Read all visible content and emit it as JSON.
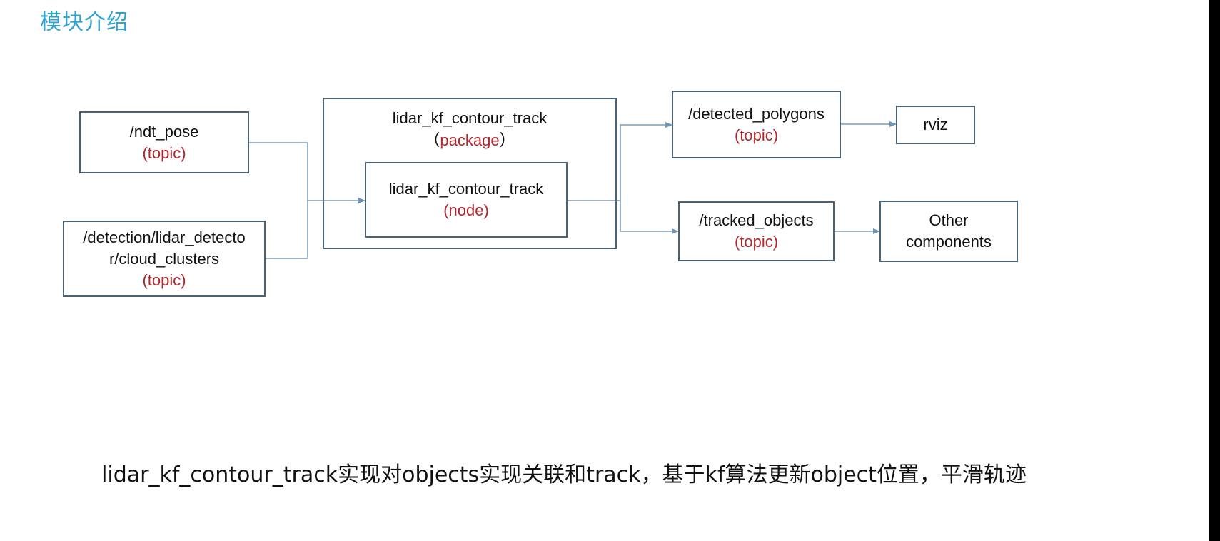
{
  "title": "模块介绍",
  "nodes": {
    "ndt_pose": {
      "name": "/ndt_pose",
      "kind": "(topic)"
    },
    "cloud_clusters": {
      "name_line1": "/detection/lidar_detecto",
      "name_line2": "r/cloud_clusters",
      "kind": "(topic)"
    },
    "package": {
      "name": "lidar_kf_contour_track",
      "kind_open": "（",
      "kind": "package",
      "kind_close": "）"
    },
    "node": {
      "name": "lidar_kf_contour_track",
      "kind": "(node)"
    },
    "detected_polygons": {
      "name": "/detected_polygons",
      "kind": "(topic)"
    },
    "tracked_objects": {
      "name": "/tracked_objects",
      "kind": "(topic)"
    },
    "rviz": {
      "name": "rviz"
    },
    "other": {
      "line1": "Other",
      "line2": "components"
    }
  },
  "caption": "lidar_kf_contour_track实现对objects实现关联和track，基于kf算法更新object位置，平滑轨迹",
  "colors": {
    "title": "#2ea3cf",
    "type_label": "#b0262c",
    "border": "#4a6275",
    "connector": "#7a9bb8"
  }
}
